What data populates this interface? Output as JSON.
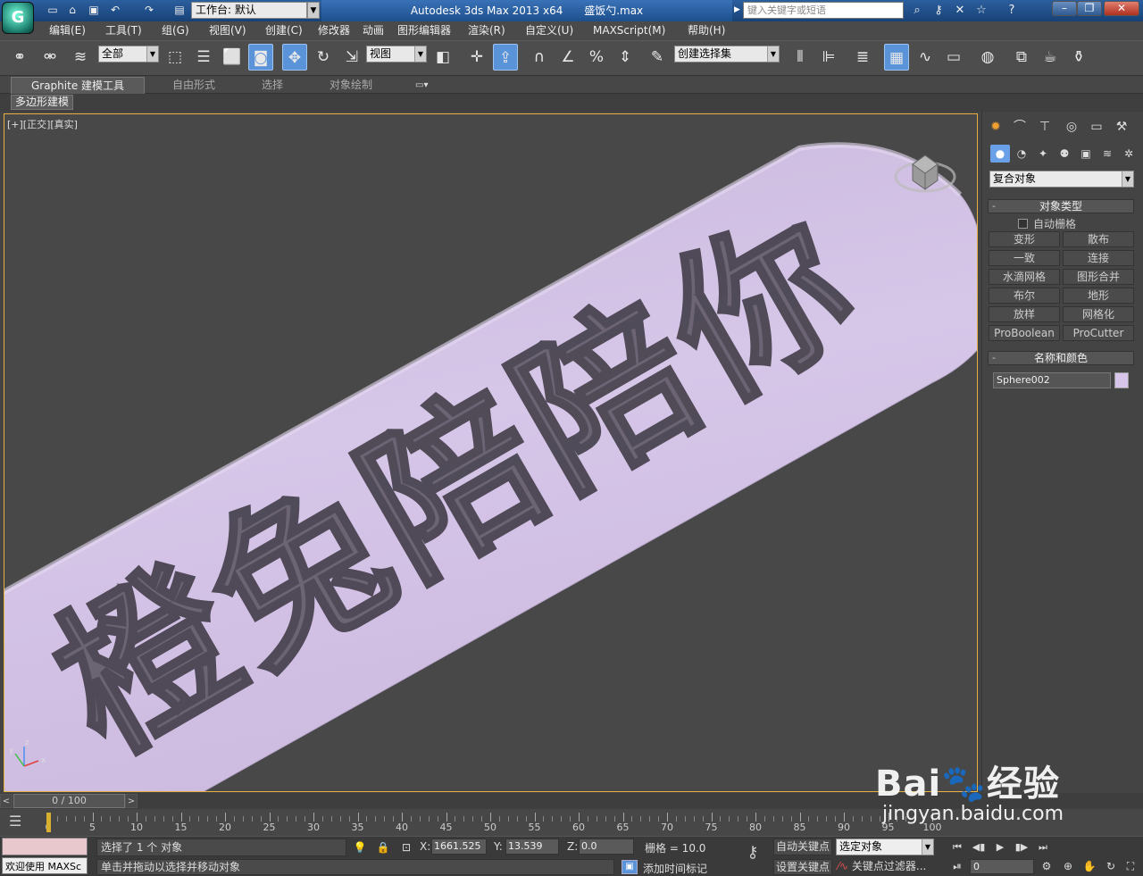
{
  "titlebar": {
    "workspace_label": "工作台: 默认",
    "app_title": "Autodesk 3ds Max  2013 x64",
    "file_name": "盛饭勺.max",
    "search_placeholder": "键入关键字或短语"
  },
  "menus": [
    "编辑(E)",
    "工具(T)",
    "组(G)",
    "视图(V)",
    "创建(C)",
    "修改器",
    "动画",
    "图形编辑器",
    "渲染(R)",
    "自定义(U)",
    "MAXScript(M)",
    "帮助(H)"
  ],
  "toolbar": {
    "filter_value": "全部",
    "refcoord_value": "视图",
    "named_selection_value": "创建选择集"
  },
  "ribbon": {
    "tabs": [
      "Graphite 建模工具",
      "自由形式",
      "选择",
      "对象绘制"
    ],
    "subtab": "多边形建模"
  },
  "viewport": {
    "label": "[+][正交][真实]",
    "engraved_text": "橙兔陪陪你",
    "axis_labels": {
      "z": "z",
      "y": "y",
      "x": "x"
    }
  },
  "command_panel": {
    "category_value": "复合对象",
    "object_type_header": "对象类型",
    "auto_grid_label": "自动栅格",
    "object_types": [
      "变形",
      "散布",
      "一致",
      "连接",
      "水滴网格",
      "图形合并",
      "布尔",
      "地形",
      "放样",
      "网格化",
      "ProBoolean",
      "ProCutter"
    ],
    "name_color_header": "名称和颜色",
    "object_name": "Sphere002",
    "object_color": "#d8c6ea"
  },
  "timeline": {
    "slider_label": "0 / 100",
    "ticks": [
      "0",
      "5",
      "10",
      "15",
      "20",
      "25",
      "30",
      "35",
      "40",
      "45",
      "50",
      "55",
      "60",
      "65",
      "70",
      "75",
      "80",
      "85",
      "90",
      "95",
      "100"
    ]
  },
  "status": {
    "welcome": "欢迎使用 MAXSc",
    "selection_text": "选择了 1 个 对象",
    "prompt_text": "单击并拖动以选择并移动对象",
    "x_label": "X:",
    "x_value": "1661.525",
    "y_label": "Y:",
    "y_value": "13.539",
    "z_label": "Z:",
    "z_value": "0.0",
    "grid_text": "栅格 = 10.0",
    "add_time_tag": "添加时间标记",
    "auto_key": "自动关键点",
    "set_key": "设置关键点",
    "selected_dropdown": "选定对象",
    "key_filter": "关键点过滤器...",
    "frame_value": "0"
  },
  "watermark": {
    "brand": "Bai",
    "brand_cn": "经验",
    "url": "jingyan.baidu.com"
  }
}
